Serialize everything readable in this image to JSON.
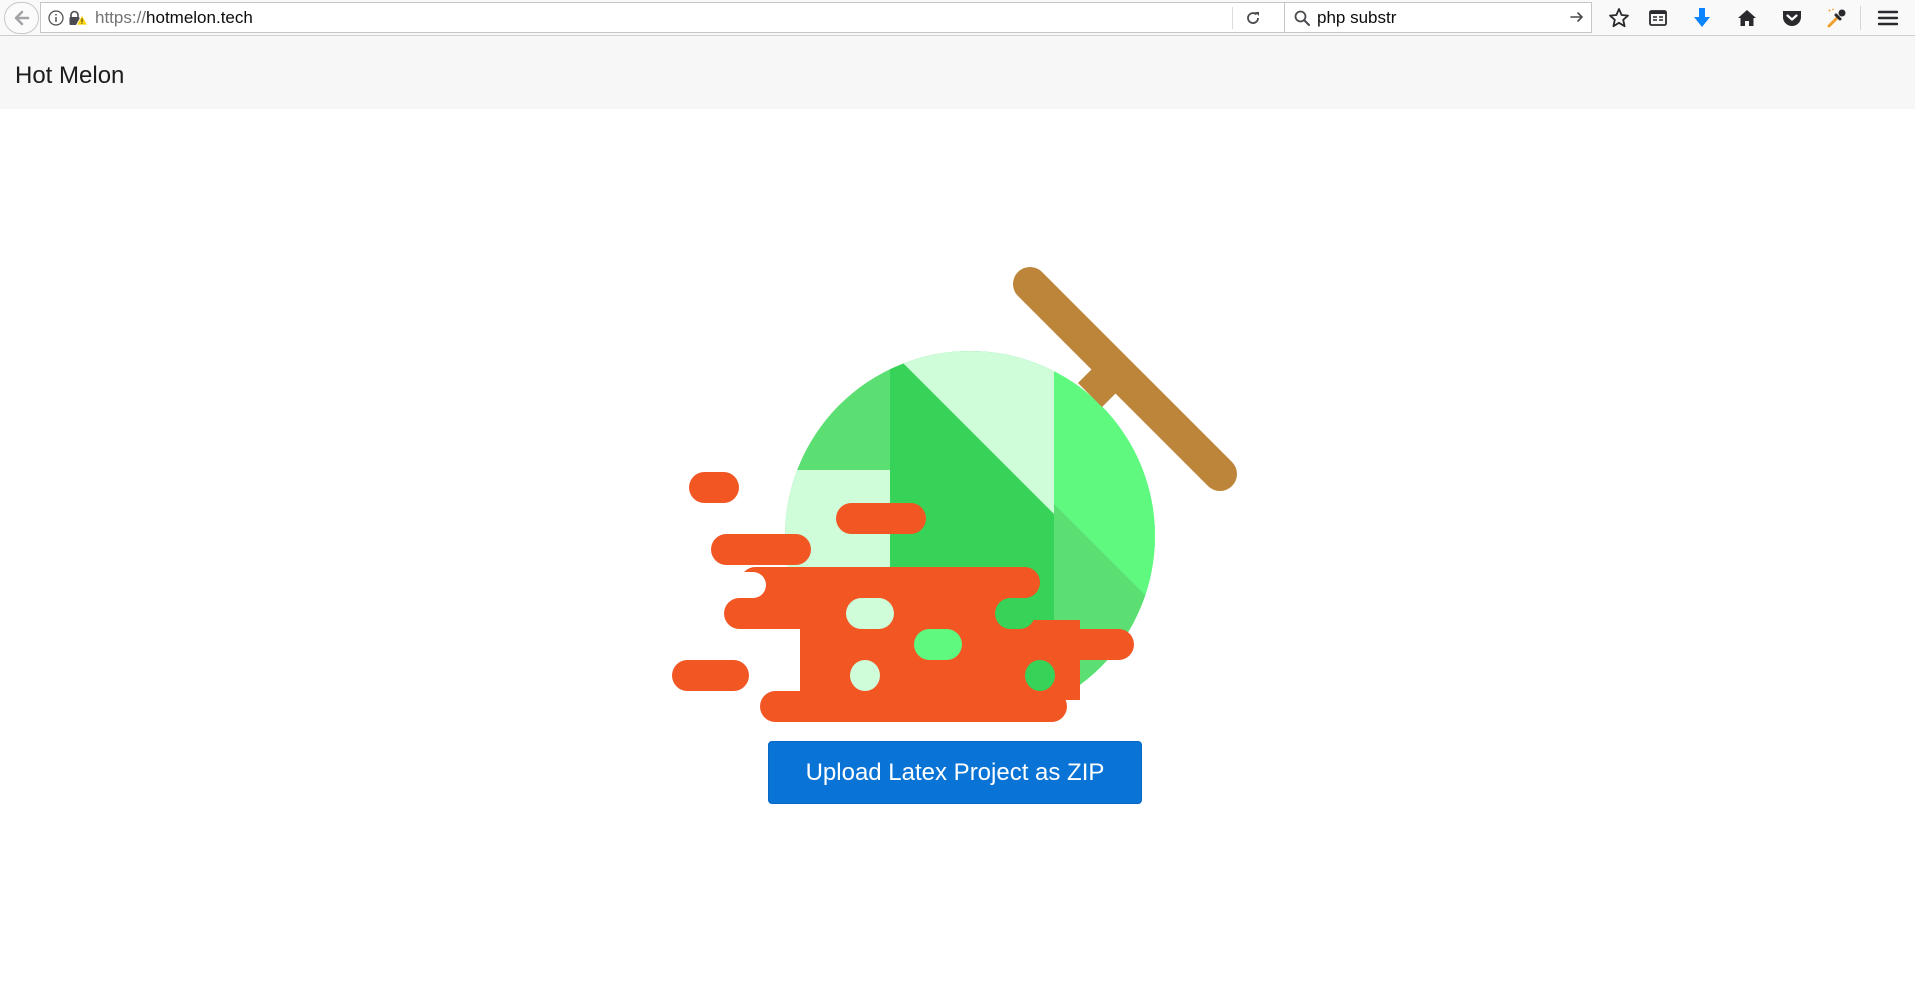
{
  "browser": {
    "url_protocol": "https://",
    "url_host": "hotmelon.tech",
    "search_value": "php substr",
    "icons": [
      "back-arrow-icon",
      "info-icon",
      "insecure-lock-icon",
      "reload-icon",
      "search-icon",
      "go-arrow-icon",
      "bookmark-star-icon",
      "reading-list-icon",
      "download-icon",
      "home-icon",
      "pocket-icon",
      "dropper-icon",
      "hamburger-menu-icon"
    ]
  },
  "navbar": {
    "brand": "Hot Melon"
  },
  "hero": {
    "logo": "melon-splat-logo",
    "upload_label": "Upload Latex Project as ZIP"
  },
  "colors": {
    "accent_blue": "#0a74d6",
    "splat_orange": "#f15623",
    "melon_green": "#37d258",
    "melon_light": "#cffcd9",
    "stick_brown": "#bd853a"
  }
}
